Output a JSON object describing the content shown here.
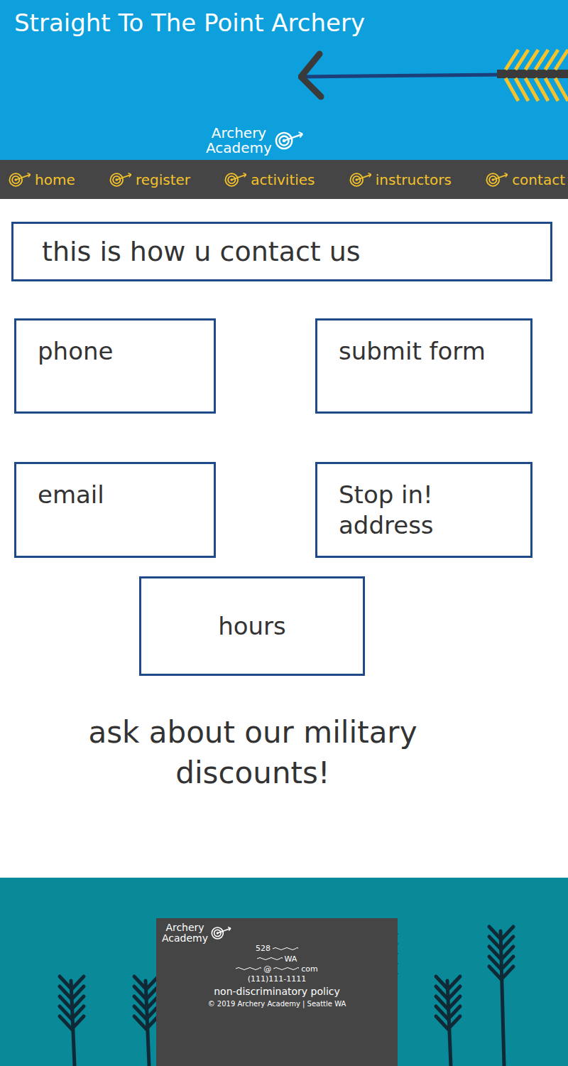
{
  "header": {
    "title": "Straight To The Point Archery",
    "logo": [
      "Archery",
      "Academy"
    ]
  },
  "nav": [
    {
      "label": "home",
      "selected": false
    },
    {
      "label": "register",
      "selected": false
    },
    {
      "label": "activities",
      "selected": false
    },
    {
      "label": "instructors",
      "selected": false
    },
    {
      "label": "contact",
      "selected": false
    }
  ],
  "intro": "this is how u contact us",
  "cards": [
    {
      "lines": [
        "phone"
      ]
    },
    {
      "lines": [
        "submit form"
      ]
    },
    {
      "lines": [
        "email"
      ]
    },
    {
      "lines": [
        "Stop in!",
        "address"
      ]
    }
  ],
  "hours": {
    "lines": [
      "hours"
    ]
  },
  "promo": "ask about our military discounts!",
  "footer": {
    "logo": [
      "Archery",
      "Academy"
    ],
    "rows": [
      {
        "segments": [
          "528"
        ],
        "lead": false,
        "trail": true
      },
      {
        "segments": [
          "WA"
        ],
        "lead": true,
        "trail": false
      },
      {
        "segments": [
          "@",
          "com"
        ],
        "lead": true,
        "trail": false
      },
      {
        "segments": [
          "(111)111-1111"
        ],
        "lead": false,
        "trail": false
      }
    ],
    "policy": "non-discriminatory policy",
    "copyright": "© 2019 Archery Academy | Seattle WA"
  }
}
